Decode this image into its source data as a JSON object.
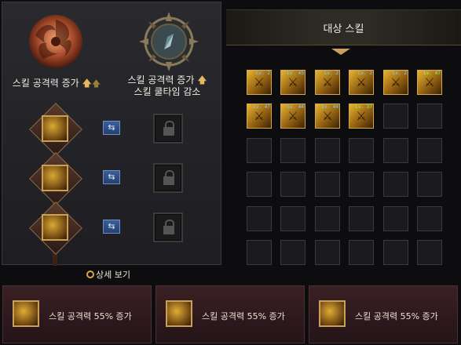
{
  "left": {
    "tree_a_title": "스킬 공격력 증가",
    "tree_b_title_line1": "스킬 공격력 증가",
    "tree_b_title_line2": "스킬 쿨타임 감소",
    "slots": [
      {
        "icon": "skill-icon-warrior-1",
        "swap_glyph": "⇆",
        "locked": true
      },
      {
        "icon": "skill-icon-warrior-2",
        "swap_glyph": "⇆",
        "locked": true
      },
      {
        "icon": "skill-icon-warrior-3",
        "swap_glyph": "⇆",
        "locked": true
      }
    ]
  },
  "target": {
    "title": "대상 스킬",
    "skills": [
      {
        "lv": "Lv. 2",
        "lv_color": "blue",
        "icon": "skill-slash-icon"
      },
      {
        "lv": "Lv. 45",
        "lv_color": "blue",
        "icon": "skill-strike-icon"
      },
      {
        "lv": "Lv. 2",
        "lv_color": "blue",
        "icon": "skill-dash-icon"
      },
      {
        "lv": "Lv. 2",
        "lv_color": "blue",
        "icon": "skill-burst-icon"
      },
      {
        "lv": "Lv. 2",
        "lv_color": "blue",
        "icon": "skill-wave-icon"
      },
      {
        "lv": "Lv. 47",
        "lv_color": "green",
        "icon": "skill-charge-icon"
      },
      {
        "lv": "Lv. 47",
        "lv_color": "blue",
        "icon": "skill-claw-icon"
      },
      {
        "lv": "Lv. 44",
        "lv_color": "blue",
        "icon": "skill-spin-icon"
      },
      {
        "lv": "Lv. 44",
        "lv_color": "blue",
        "icon": "skill-leap-icon"
      },
      {
        "lv": "Lv. 37",
        "lv_color": "green",
        "icon": "skill-roar-icon"
      }
    ],
    "empty_cells": 26
  },
  "detail_link": "상세 보기",
  "cards": [
    {
      "text": "스킬 공격력 55% 증가",
      "icon": "skill-icon-warrior-1"
    },
    {
      "text": "스킬 공격력 55% 증가",
      "icon": "skill-icon-warrior-2"
    },
    {
      "text": "스킬 공격력 55% 증가",
      "icon": "skill-icon-warrior-3"
    }
  ],
  "colors": {
    "accent_gold": "#d6a84a",
    "panel_bg": "#26262a",
    "card_bg": "#3a2024"
  }
}
